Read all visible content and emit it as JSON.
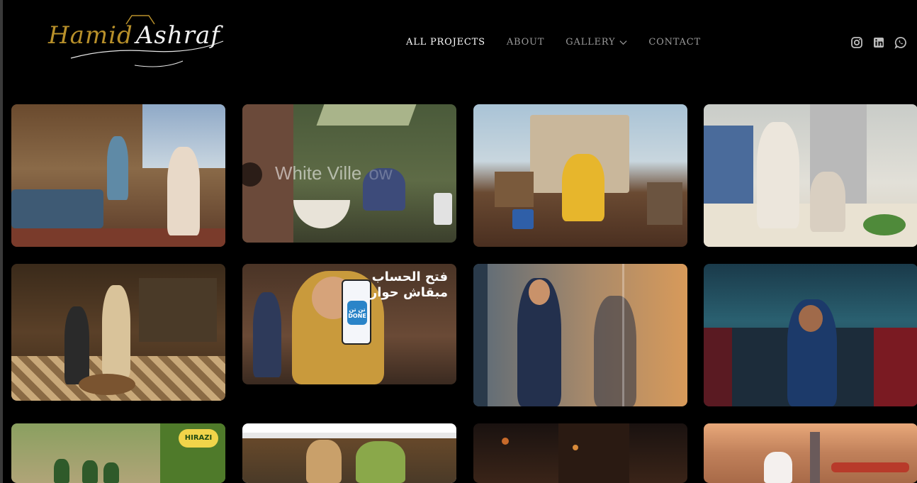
{
  "brand": {
    "logo_first": "Hamid",
    "logo_last": "Ashraf",
    "gold": "#b8902a"
  },
  "nav": {
    "items": [
      {
        "label": "ALL PROJECTS",
        "active": true
      },
      {
        "label": "ABOUT",
        "active": false
      },
      {
        "label": "GALLERY",
        "active": false,
        "has_dropdown": true
      },
      {
        "label": "CONTACT",
        "active": false
      }
    ]
  },
  "socials": [
    "instagram-icon",
    "linkedin-icon",
    "whatsapp-icon"
  ],
  "projects": [
    {
      "name": "Family living room scene"
    },
    {
      "name": "White Ville bathroom",
      "caption": "White Ville",
      "caption_tail": "ow"
    },
    {
      "name": "Fisherman on boat deck"
    },
    {
      "name": "Mother and child in kitchen"
    },
    {
      "name": "Tailor shop fitting"
    },
    {
      "name": "Arab Bank account opening",
      "headline_1": "فتح الحساب",
      "headline_2": "مبقاش حوار",
      "badge": "تن تن",
      "badge_2": "DONE"
    },
    {
      "name": "Man in blue blazer reflection"
    },
    {
      "name": "Man in uniform in locker room"
    },
    {
      "name": "Hirazi store",
      "badge": "HIRAZI"
    },
    {
      "name": "Bank campaign duo"
    },
    {
      "name": "Night scene"
    },
    {
      "name": "Bride at lighthouse sunset"
    }
  ]
}
